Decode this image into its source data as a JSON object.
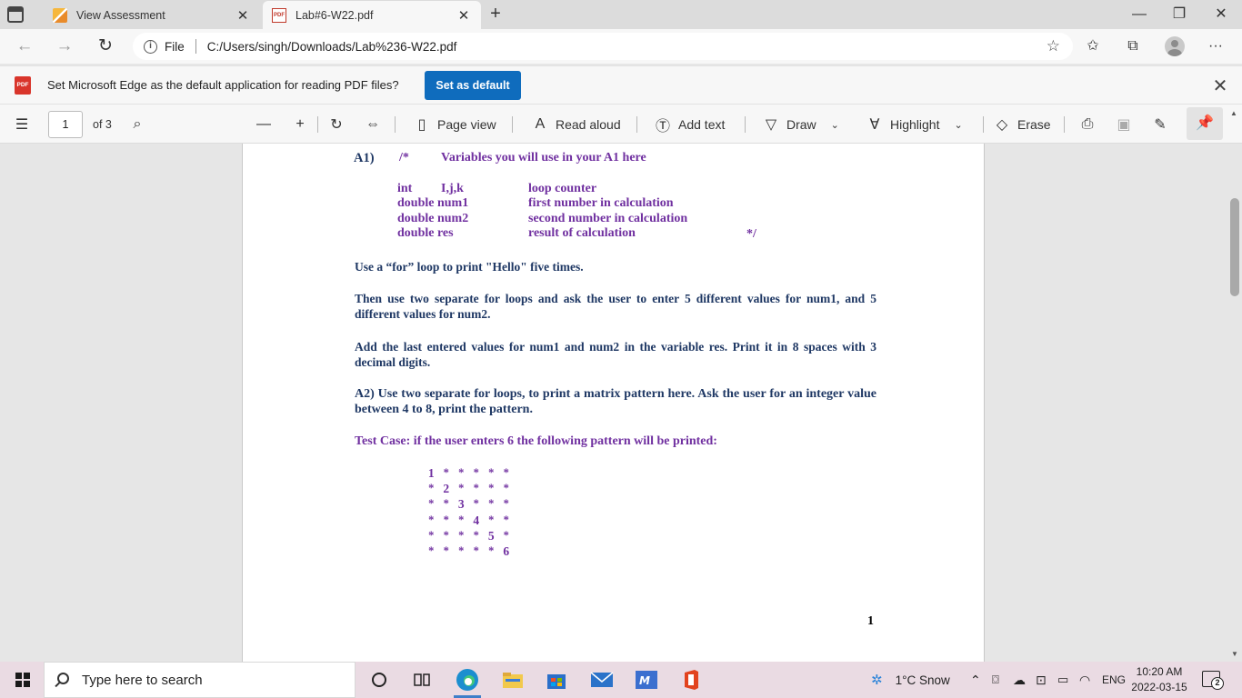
{
  "tabs": [
    {
      "title": "View Assessment",
      "icon": "pencil-favicon"
    },
    {
      "title": "Lab#6-W22.pdf",
      "icon": "pdf-favicon"
    }
  ],
  "address": {
    "scheme_label": "File",
    "url": "C:/Users/singh/Downloads/Lab%236-W22.pdf"
  },
  "infobar": {
    "badge": "PDF",
    "message": "Set Microsoft Edge as the default application for reading PDF files?",
    "button": "Set as default"
  },
  "pdf_toolbar": {
    "page_number": "1",
    "page_count": "of 3",
    "page_view": "Page view",
    "read_aloud": "Read aloud",
    "add_text": "Add text",
    "draw": "Draw",
    "highlight": "Highlight",
    "erase": "Erase"
  },
  "document": {
    "a1_label": "A1)",
    "comment_open": "/*",
    "comment_title": "Variables you will use in your A1 here",
    "variables": [
      {
        "type": "int",
        "name": "I,j,k",
        "desc": "loop counter"
      },
      {
        "type": "double num1",
        "name": "",
        "desc": "first number in calculation"
      },
      {
        "type": "double num2",
        "name": "",
        "desc": "second number in calculation"
      },
      {
        "type": "double res",
        "name": "",
        "desc": "result of calculation"
      }
    ],
    "comment_close": "*/",
    "para1": "Use a “for” loop to print \"Hello\" five times.",
    "para2": "Then use two separate for loops and ask the user to enter 5 different values for num1, and 5 different values for num2.",
    "para3": "Add the last entered values for num1 and num2 in the variable res. Print it in 8 spaces with 3 decimal digits.",
    "para4": "A2) Use two separate for loops, to print a matrix pattern here. Ask the user for an integer value between 4 to 8, print the pattern.",
    "test_case": "Test Case:  if the user enters 6 the following pattern will be printed:",
    "pattern_rows": [
      [
        "1",
        "*",
        "*",
        "*",
        "*",
        "*"
      ],
      [
        "*",
        "2",
        "*",
        "*",
        "*",
        "*"
      ],
      [
        "*",
        "*",
        "3",
        "*",
        "*",
        "*"
      ],
      [
        "*",
        "*",
        "*",
        "4",
        "*",
        "*"
      ],
      [
        "*",
        "*",
        "*",
        "*",
        "5",
        "*"
      ],
      [
        "*",
        "*",
        "*",
        "*",
        "*",
        "6"
      ]
    ],
    "page_number": "1"
  },
  "taskbar": {
    "search_placeholder": "Type here to search",
    "weather": "1°C  Snow",
    "language": "ENG",
    "time": "10:20 AM",
    "date": "2022-03-15",
    "notification_count": "2"
  }
}
